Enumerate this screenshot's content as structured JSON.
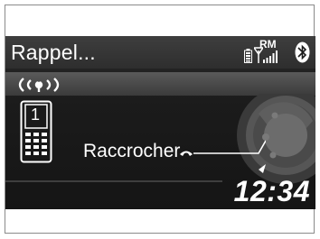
{
  "header": {
    "title": "Rappel...",
    "status_icons": [
      "battery-icon",
      "signal-strength-icon",
      "bluetooth-icon"
    ],
    "roaming_label": "RM"
  },
  "connection": {
    "icon": "wireless-waves-icon",
    "text": "(((ı)))"
  },
  "phone": {
    "device_number": "1",
    "icon": "mobile-phone-icon"
  },
  "action": {
    "label": "Raccrocher",
    "icon": "hang-up-icon"
  },
  "clock": {
    "time": "12:34"
  }
}
